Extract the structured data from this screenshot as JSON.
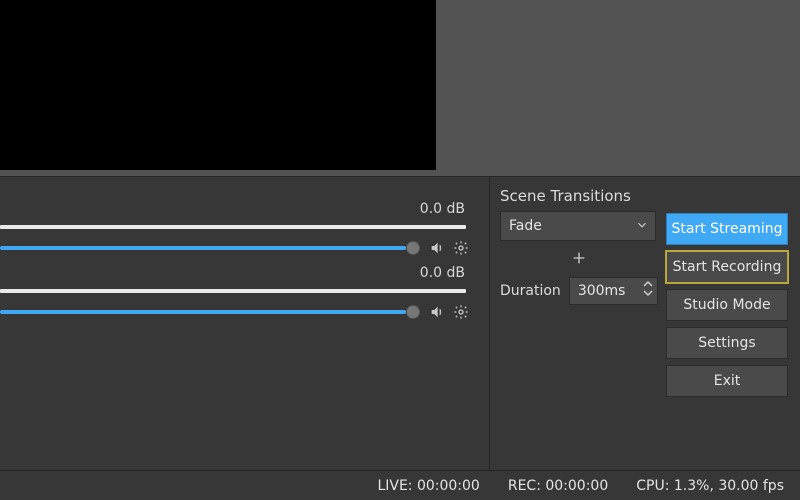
{
  "mixer": {
    "channels": [
      {
        "db": "0.0 dB"
      },
      {
        "db": "0.0 dB"
      }
    ]
  },
  "transitions": {
    "title": "Scene Transitions",
    "selected": "Fade",
    "duration_label": "Duration",
    "duration_value": "300ms"
  },
  "controls": {
    "start_streaming": "Start Streaming",
    "start_recording": "Start Recording",
    "studio_mode": "Studio Mode",
    "settings": "Settings",
    "exit": "Exit"
  },
  "status": {
    "live": "LIVE: 00:00:00",
    "rec": "REC: 00:00:00",
    "cpu": "CPU: 1.3%, 30.00 fps"
  }
}
